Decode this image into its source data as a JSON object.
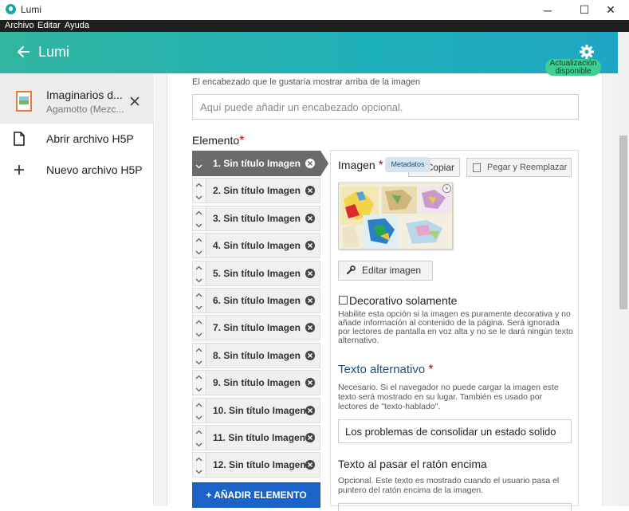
{
  "window": {
    "title": "Lumi",
    "minimize": "─",
    "maximize": "☐",
    "close": "✕"
  },
  "menu": [
    "Archivo",
    "Editar",
    "Ayuda"
  ],
  "header": {
    "app_name": "Lumi",
    "update_badge": "Actualización disponible"
  },
  "sidebar": {
    "file": {
      "name": "Imaginarios d...",
      "subtitle": "Agamotto (Mezc..."
    },
    "open_label": "Abrir archivo H5P",
    "new_label": "Nuevo archivo H5P"
  },
  "editor": {
    "header_description": "El encabezado que le gustaría mostrar arriba de la imagen",
    "header_placeholder": "Aquí puede añadir un encabezado opcional.",
    "elements_label": "Elemento",
    "required_mark": "*",
    "elements": [
      "1. Sin título Imagen",
      "2. Sin título Imagen",
      "3. Sin título Imagen",
      "4. Sin título Imagen",
      "5. Sin título Imagen",
      "6. Sin título Imagen",
      "7. Sin título Imagen",
      "8. Sin título Imagen",
      "9. Sin título Imagen",
      "10. Sin título Imagen",
      "11. Sin título Imagen",
      "12. Sin título Imagen"
    ],
    "active_index": 0,
    "add_element": "+ AÑADIR ELEMENTO",
    "image_label": "Imagen",
    "metadata_badge": "Metadatos",
    "copy_button": "Copiar",
    "paste_button": "Pegar y Reemplazar",
    "thumb_close": "×",
    "edit_image_button": "Editar imagen",
    "decorative_label": "Decorativo solamente",
    "decorative_desc": "Habilite esta opción si la imagen es puramente decorativa y no añade información al contenido de la página. Será ignorada por lectores de pantalla en voz alta y no se le dará ningún texto alternativo.",
    "alt_label": "Texto alternativo",
    "alt_desc": "Necesario. Si el navegador no puede cargar la imagen este texto será mostrado en su lugar. También es usado por lectores de \"texto-hablado\".",
    "alt_value": "Los problemas de consolidar un estado solido",
    "hover_label": "Texto al pasar el ratón encima",
    "hover_desc": "Opcional. Este texto es mostrado cuando el usuario pasa el puntero del ratón encima de la imagen."
  },
  "colors": {
    "header_start": "#31b5a0",
    "header_end": "#1ea6c4",
    "add_button": "#1c63c7",
    "active_element": "#6a6a6a",
    "required": "#cc0000",
    "update_badge": "#3fcf92"
  }
}
